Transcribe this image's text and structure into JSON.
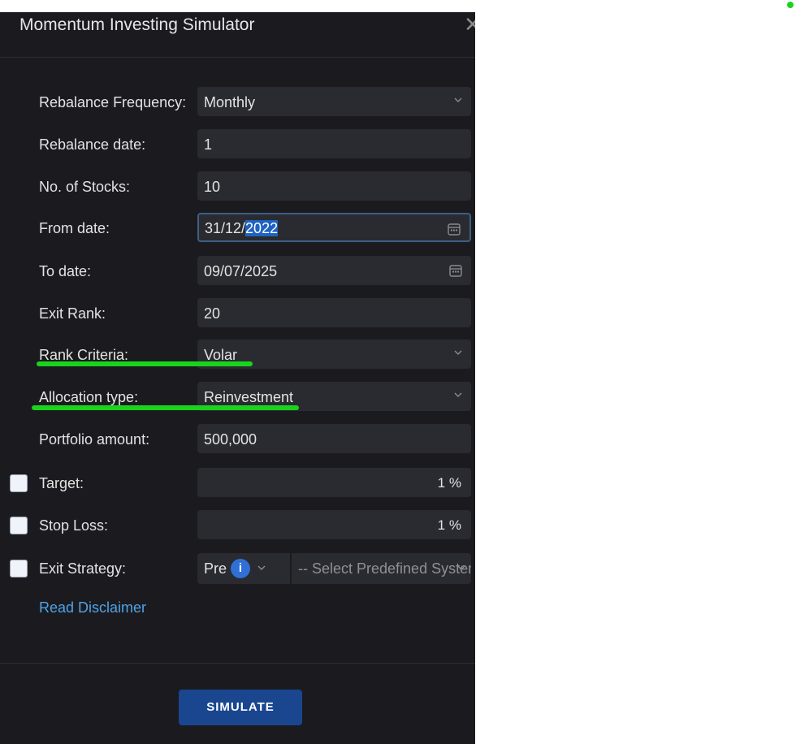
{
  "dialog": {
    "title": "Momentum Investing Simulator",
    "close_glyph": "✕"
  },
  "form": {
    "rebalance_frequency": {
      "label": "Rebalance Frequency:",
      "value": "Monthly"
    },
    "rebalance_date": {
      "label": "Rebalance date:",
      "value": "1"
    },
    "num_stocks": {
      "label": "No. of Stocks:",
      "value": "10"
    },
    "from_date": {
      "label": "From date:",
      "value_prefix": "31/12/",
      "value_selected": "2022"
    },
    "to_date": {
      "label": "To date:",
      "value": "09/07/2025"
    },
    "exit_rank": {
      "label": "Exit Rank:",
      "value": "20"
    },
    "rank_criteria": {
      "label": "Rank Criteria:",
      "value": "Volar"
    },
    "allocation_type": {
      "label": "Allocation type:",
      "value": "Reinvestment"
    },
    "portfolio_amount": {
      "label": "Portfolio amount:",
      "value": "500,000"
    },
    "target": {
      "label": "Target:",
      "value": "1",
      "unit": "%",
      "checked": false
    },
    "stop_loss": {
      "label": "Stop Loss:",
      "value": "1",
      "unit": "%",
      "checked": false
    },
    "exit_strategy": {
      "label": "Exit Strategy:",
      "mode": "Pre",
      "info": "i",
      "system_placeholder": "-- Select Predefined System --",
      "checked": false
    }
  },
  "links": {
    "disclaimer": "Read Disclaimer"
  },
  "actions": {
    "simulate": "SIMULATE"
  },
  "colors": {
    "panel_bg": "#1b1b1f",
    "field_bg": "#2a2b31",
    "accent_blue": "#1a4690",
    "annotation_green": "#19d31c",
    "link": "#4fa3e8"
  }
}
